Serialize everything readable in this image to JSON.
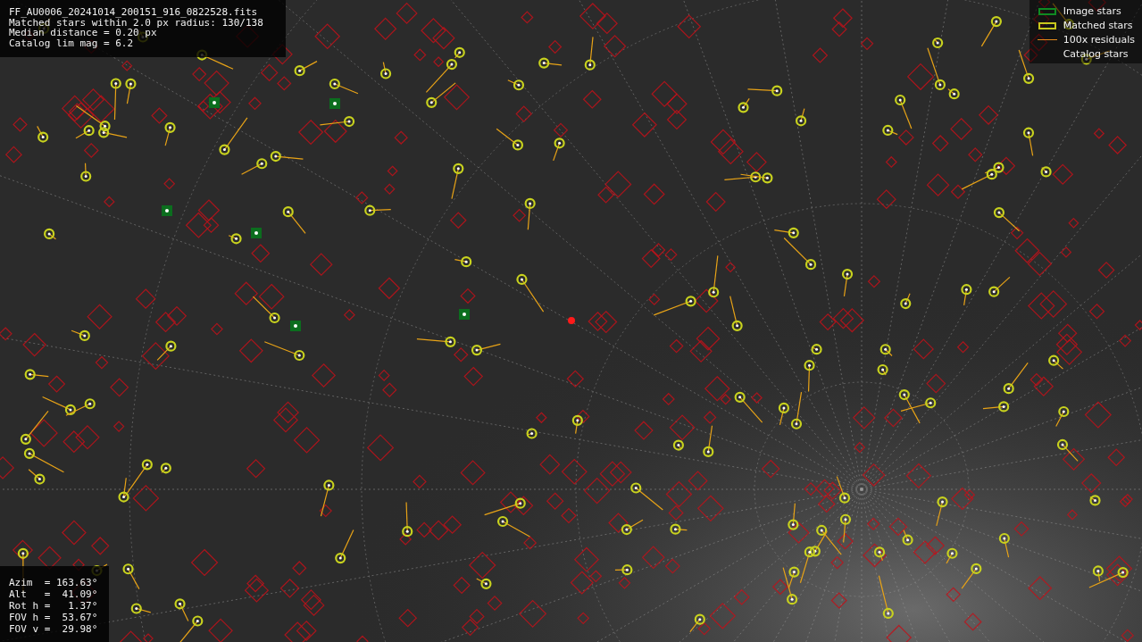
{
  "info_lines": [
    "FF_AU0006_20241014_200151_916_0822528.fits",
    "Matched stars within 2.0 px radius: 130/138",
    "Median distance = 0.20 px",
    "Catalog lim mag = 6.2"
  ],
  "legend": [
    {
      "kind": "image",
      "label": "Image stars"
    },
    {
      "kind": "matched",
      "label": "Matched stars"
    },
    {
      "kind": "residual",
      "label": "100x residuals"
    },
    {
      "kind": "catalog",
      "label": "Catalog stars"
    }
  ],
  "pointing": [
    "Azim  = 163.63°",
    "Alt   =  41.09°",
    "Rot h =   1.37°",
    "FOV h =  53.67°",
    "FOV v =  29.98°"
  ]
}
